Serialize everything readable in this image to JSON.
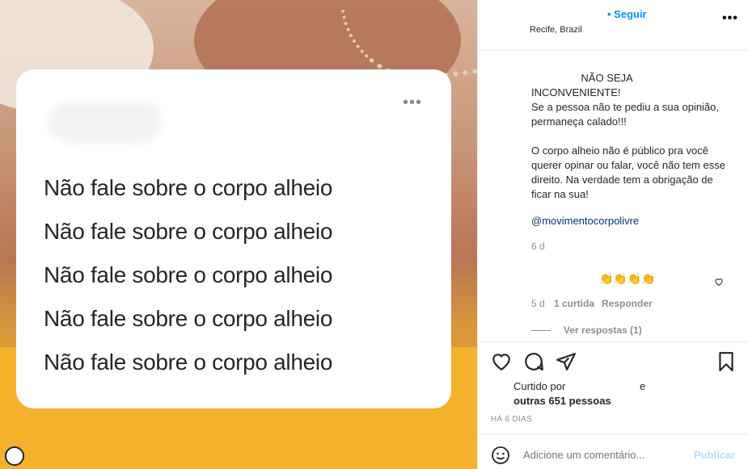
{
  "post": {
    "image_lines": [
      "Não fale sobre o corpo alheio",
      "Não fale sobre o corpo alheio",
      "Não fale sobre o corpo alheio",
      "Não fale sobre o corpo alheio",
      "Não fale sobre o corpo alheio"
    ],
    "card_menu": "•••"
  },
  "header": {
    "follow_label": "• Seguir",
    "location": "Recife, Brazil",
    "menu": "•••"
  },
  "caption": {
    "text": "                 NÃO SEJA\nINCONVENIENTE!\nSe a pessoa não te pediu a sua opinião, permaneça calado!!!\n\nO corpo alheio não é público pra você querer opinar ou falar, você não tem esse direito. Na verdade tem a obrigação de ficar na sua!",
    "mention": "@movimentocorpolivre",
    "time": "6 d"
  },
  "comment": {
    "emoji": "👏👏👏👏",
    "time": "5 d",
    "likes": "1 curtida",
    "reply": "Responder",
    "view_replies": "Ver respostas (1)"
  },
  "likes": {
    "liked_by": "Curtido por",
    "and": "e",
    "others": "outras 651 pessoas",
    "ago": "HÁ 6 DIAS"
  },
  "comment_box": {
    "placeholder": "Adicione um comentário...",
    "publish": "Publicar"
  },
  "icons": [
    "heart-icon",
    "comment-icon",
    "share-icon",
    "bookmark-icon",
    "emoji-icon",
    "ellipsis-icon",
    "profile-icon"
  ]
}
